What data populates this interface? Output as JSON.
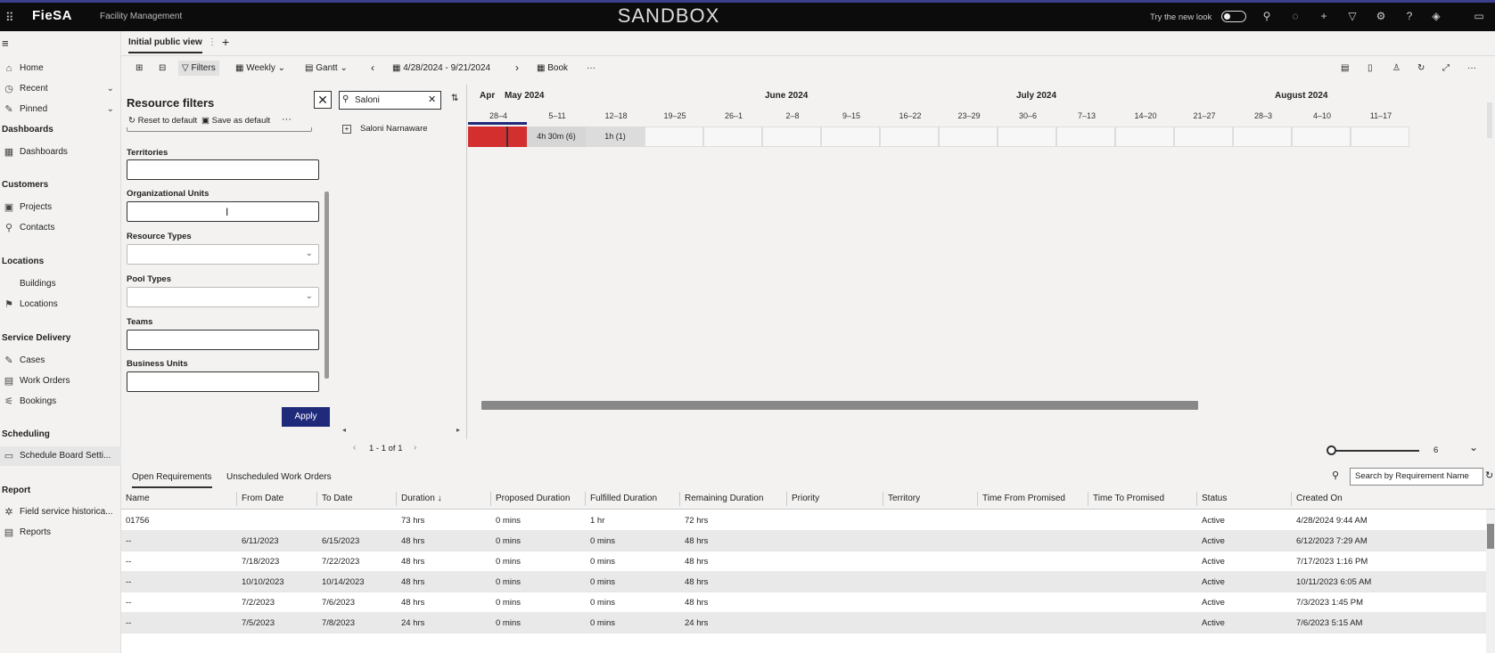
{
  "topbar": {
    "logo": "FieSA",
    "app_name": "Facility Management",
    "environment": "SANDBOX",
    "try_new_look": "Try the new look",
    "icons": [
      "search-icon",
      "lightbulb-icon",
      "plus-icon",
      "filter-icon",
      "gear-icon",
      "help-icon",
      "assist-icon",
      "chat-icon"
    ]
  },
  "nav": {
    "items": [
      {
        "label": "Home",
        "icon": "⌂"
      },
      {
        "label": "Recent",
        "icon": "◷",
        "chevron": "⌄"
      },
      {
        "label": "Pinned",
        "icon": "✎",
        "chevron": "⌄"
      },
      {
        "label": "Dashboards",
        "icon": "▦"
      },
      {
        "label": "Projects",
        "icon": "▣"
      },
      {
        "label": "Contacts",
        "icon": "⚲"
      },
      {
        "label": "Buildings",
        "icon": ""
      },
      {
        "label": "Locations",
        "icon": "⚑"
      },
      {
        "label": "Cases",
        "icon": "✎"
      },
      {
        "label": "Work Orders",
        "icon": "▤"
      },
      {
        "label": "Bookings",
        "icon": "⚟"
      },
      {
        "label": "Schedule Board Setti...",
        "icon": "▭"
      },
      {
        "label": "Field service historica...",
        "icon": "✲"
      },
      {
        "label": "Reports",
        "icon": "▤"
      }
    ],
    "sections": [
      "Dashboards",
      "Customers",
      "Locations",
      "Service Delivery",
      "Scheduling",
      "Report"
    ]
  },
  "tabs": {
    "active": "Initial public view"
  },
  "toolbar": {
    "filters": "Filters",
    "weekly": "Weekly",
    "gantt": "Gantt",
    "date_range": "4/28/2024 - 9/21/2024",
    "book": "Book",
    "more": "···"
  },
  "filters": {
    "title": "Resource filters",
    "reset": "Reset to default",
    "save": "Save as default",
    "more": "···",
    "fields": [
      "Territories",
      "Organizational Units",
      "Resource Types",
      "Pool Types",
      "Teams",
      "Business Units"
    ],
    "apply": "Apply"
  },
  "resources": {
    "search_value": "Saloni",
    "items": [
      "Saloni Narnaware"
    ],
    "pagination": "1 - 1 of 1"
  },
  "gantt": {
    "months": [
      "Apr",
      "May 2024",
      "June 2024",
      "July 2024",
      "August 2024"
    ],
    "weeks": [
      "28–4",
      "5–11",
      "12–18",
      "19–25",
      "26–1",
      "2–8",
      "9–15",
      "16–22",
      "23–29",
      "30–6",
      "7–13",
      "14–20",
      "21–27",
      "28–3",
      "4–10",
      "11–17"
    ],
    "bookings": [
      {
        "label": "",
        "color": "#d32f2f"
      },
      {
        "label": "4h 30m (6)"
      },
      {
        "label": "1h (1)"
      }
    ],
    "zoom_value": "6"
  },
  "requirements": {
    "tabs": [
      "Open Requirements",
      "Unscheduled Work Orders"
    ],
    "search_placeholder": "Search by Requirement Name",
    "columns": [
      "Name",
      "From Date",
      "To Date",
      "Duration ↓",
      "Proposed Duration",
      "Fulfilled Duration",
      "Remaining Duration",
      "Priority",
      "Territory",
      "Time From Promised",
      "Time To Promised",
      "Status",
      "Created On"
    ],
    "rows": [
      [
        "01756",
        "",
        "",
        "73 hrs",
        "0 mins",
        "1 hr",
        "72 hrs",
        "",
        "",
        "",
        "",
        "Active",
        "4/28/2024 9:44 AM"
      ],
      [
        "--",
        "6/11/2023",
        "6/15/2023",
        "48 hrs",
        "0 mins",
        "0 mins",
        "48 hrs",
        "",
        "",
        "",
        "",
        "Active",
        "6/12/2023 7:29 AM"
      ],
      [
        "--",
        "7/18/2023",
        "7/22/2023",
        "48 hrs",
        "0 mins",
        "0 mins",
        "48 hrs",
        "",
        "",
        "",
        "",
        "Active",
        "7/17/2023 1:16 PM"
      ],
      [
        "--",
        "10/10/2023",
        "10/14/2023",
        "48 hrs",
        "0 mins",
        "0 mins",
        "48 hrs",
        "",
        "",
        "",
        "",
        "Active",
        "10/11/2023 6:05 AM"
      ],
      [
        "--",
        "7/2/2023",
        "7/6/2023",
        "48 hrs",
        "0 mins",
        "0 mins",
        "48 hrs",
        "",
        "",
        "",
        "",
        "Active",
        "7/3/2023 1:45 PM"
      ],
      [
        "--",
        "7/5/2023",
        "7/8/2023",
        "24 hrs",
        "0 mins",
        "0 mins",
        "24 hrs",
        "",
        "",
        "",
        "",
        "Active",
        "7/6/2023 5:15 AM"
      ]
    ]
  }
}
